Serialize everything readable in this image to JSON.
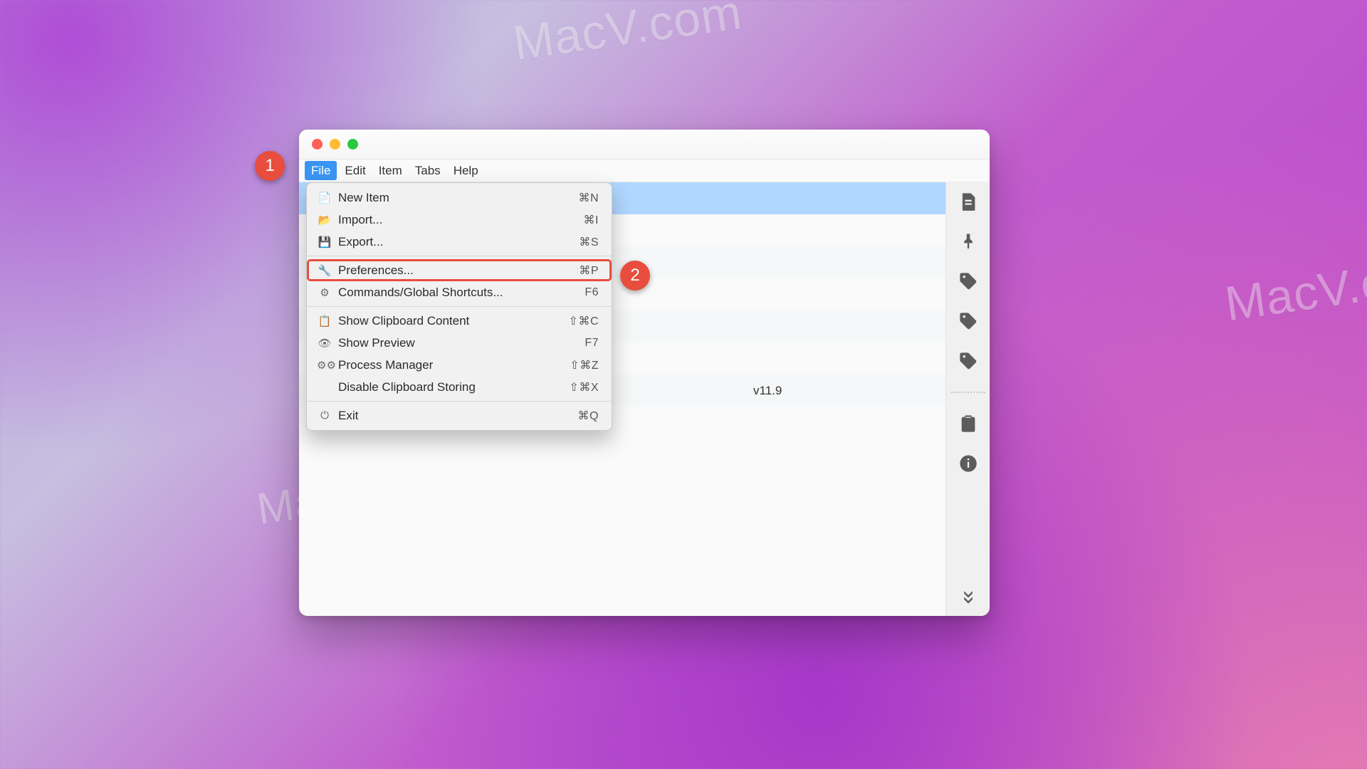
{
  "watermarks": {
    "w1": "MacV.com",
    "w2": "MacV.co",
    "w3": "MacV.com"
  },
  "menubar": {
    "file": "File",
    "edit": "Edit",
    "item": "Item",
    "tabs": "Tabs",
    "help": "Help"
  },
  "file_menu": {
    "new_item": {
      "label": "New Item",
      "shortcut": "⌘N"
    },
    "import": {
      "label": "Import...",
      "shortcut": "⌘I"
    },
    "export": {
      "label": "Export...",
      "shortcut": "⌘S"
    },
    "preferences": {
      "label": "Preferences...",
      "shortcut": "⌘P"
    },
    "commands": {
      "label": "Commands/Global Shortcuts...",
      "shortcut": "F6"
    },
    "show_clipboard": {
      "label": "Show Clipboard Content",
      "shortcut": "⇧⌘C"
    },
    "show_preview": {
      "label": "Show Preview",
      "shortcut": "F7"
    },
    "process_manager": {
      "label": "Process Manager",
      "shortcut": "⇧⌘Z"
    },
    "disable_storing": {
      "label": "Disable Clipboard Storing",
      "shortcut": "⇧⌘X"
    },
    "exit": {
      "label": "Exit",
      "shortcut": "⌘Q"
    }
  },
  "hint_tail": "v11.9",
  "callouts": {
    "one": "1",
    "two": "2"
  }
}
